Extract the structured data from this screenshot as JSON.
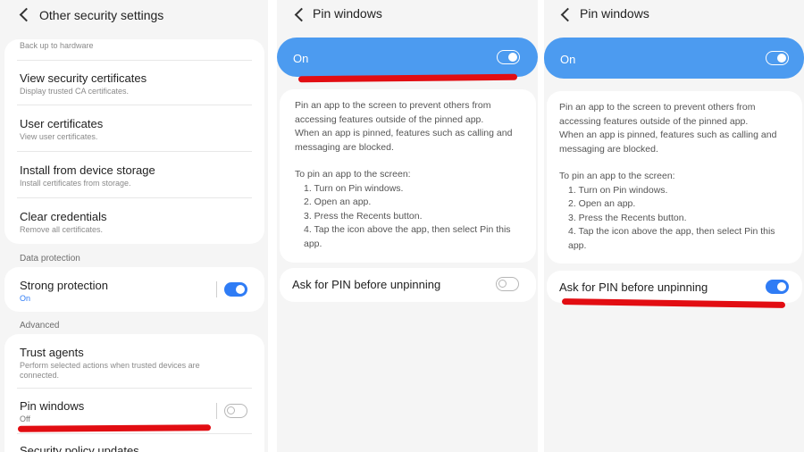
{
  "screen1": {
    "title": "Other security settings",
    "top_card": {
      "cut_sub": "Back up to hardware",
      "items": [
        {
          "label": "View security certificates",
          "sub": "Display trusted CA certificates."
        },
        {
          "label": "User certificates",
          "sub": "View user certificates."
        },
        {
          "label": "Install from device storage",
          "sub": "Install certificates from storage."
        },
        {
          "label": "Clear credentials",
          "sub": "Remove all certificates."
        }
      ]
    },
    "section_data_protection": "Data protection",
    "strong_protection": {
      "label": "Strong protection",
      "sub": "On",
      "enabled": true
    },
    "section_advanced": "Advanced",
    "trust_agents": {
      "label": "Trust agents",
      "sub_line1": "Perform selected actions when trusted devices are",
      "sub_line2": "connected."
    },
    "pin_windows": {
      "label": "Pin windows",
      "sub": "Off",
      "enabled": false
    },
    "security_policy_updates": {
      "label": "Security policy updates"
    }
  },
  "screen2": {
    "title": "Pin windows",
    "master_switch": {
      "label": "On",
      "enabled": true
    },
    "description": [
      "Pin an app to the screen to prevent others from",
      "accessing features outside of the pinned app.",
      "When an app is pinned, features such as calling and",
      "messaging are blocked."
    ],
    "how_to_title": "To pin an app to the screen:",
    "steps": [
      "1. Turn on Pin windows.",
      "2. Open an app.",
      "3. Press the Recents button.",
      "4. Tap the icon above the app, then select Pin this",
      "app."
    ],
    "ask_pin": {
      "label": "Ask for PIN before unpinning",
      "enabled": false
    }
  },
  "screen3": {
    "title": "Pin windows",
    "master_switch": {
      "label": "On",
      "enabled": true
    },
    "description": [
      "Pin an app to the screen to prevent others from",
      "accessing features outside of the pinned app.",
      "When an app is pinned, features such as calling and",
      "messaging are blocked."
    ],
    "how_to_title": "To pin an app to the screen:",
    "steps": [
      "1. Turn on Pin windows.",
      "2. Open an app.",
      "3. Press the Recents button.",
      "4. Tap the icon above the app, then select Pin this",
      "app."
    ],
    "ask_pin": {
      "label": "Ask for PIN before unpinning",
      "enabled": true
    }
  },
  "colors": {
    "accent": "#2f7cf5",
    "on_bar": "#4c9bf0",
    "annotation": "#e20d12",
    "background": "#f5f5f5"
  }
}
